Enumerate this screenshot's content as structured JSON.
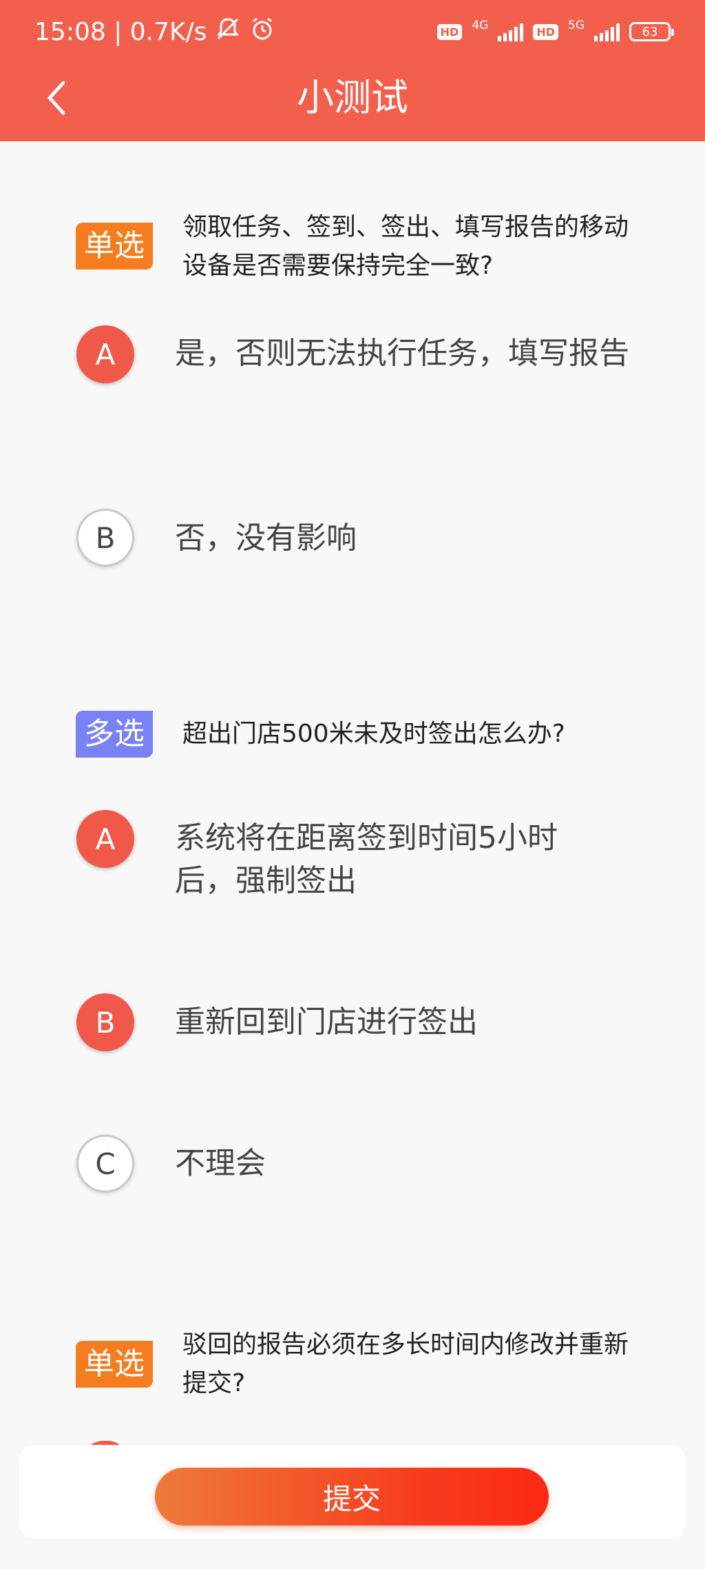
{
  "status_bar": {
    "time_speed": "15:08 | 0.7K/s",
    "hd1": "HD",
    "net1": "4G",
    "hd2": "HD",
    "net2": "5G",
    "battery": "63"
  },
  "header": {
    "title": "小测试",
    "back_icon": "chevron-left-icon"
  },
  "questions": [
    {
      "tag": "单选",
      "text": "领取任务、签到、签出、填写报告的移动设备是否需要保持完全一致?",
      "options": [
        {
          "letter": "A",
          "text": "是，否则无法执行任务，填写报告",
          "selected": true
        },
        {
          "letter": "B",
          "text": "否，没有影响",
          "selected": false
        }
      ]
    },
    {
      "tag": "多选",
      "text": "超出门店500米未及时签出怎么办?",
      "options": [
        {
          "letter": "A",
          "text": "系统将在距离签到时间5小时后，强制签出",
          "selected": true
        },
        {
          "letter": "B",
          "text": "重新回到门店进行签出",
          "selected": true
        },
        {
          "letter": "C",
          "text": "不理会",
          "selected": false
        }
      ]
    },
    {
      "tag": "单选",
      "text": "驳回的报告必须在多长时间内修改并重新提交?",
      "options": []
    }
  ],
  "submit": {
    "label": "提交"
  },
  "colors": {
    "header": "#f2604d",
    "selected": "#f0594a",
    "single_tag": "#f57d1f",
    "multi_tag": "#7982f5"
  }
}
